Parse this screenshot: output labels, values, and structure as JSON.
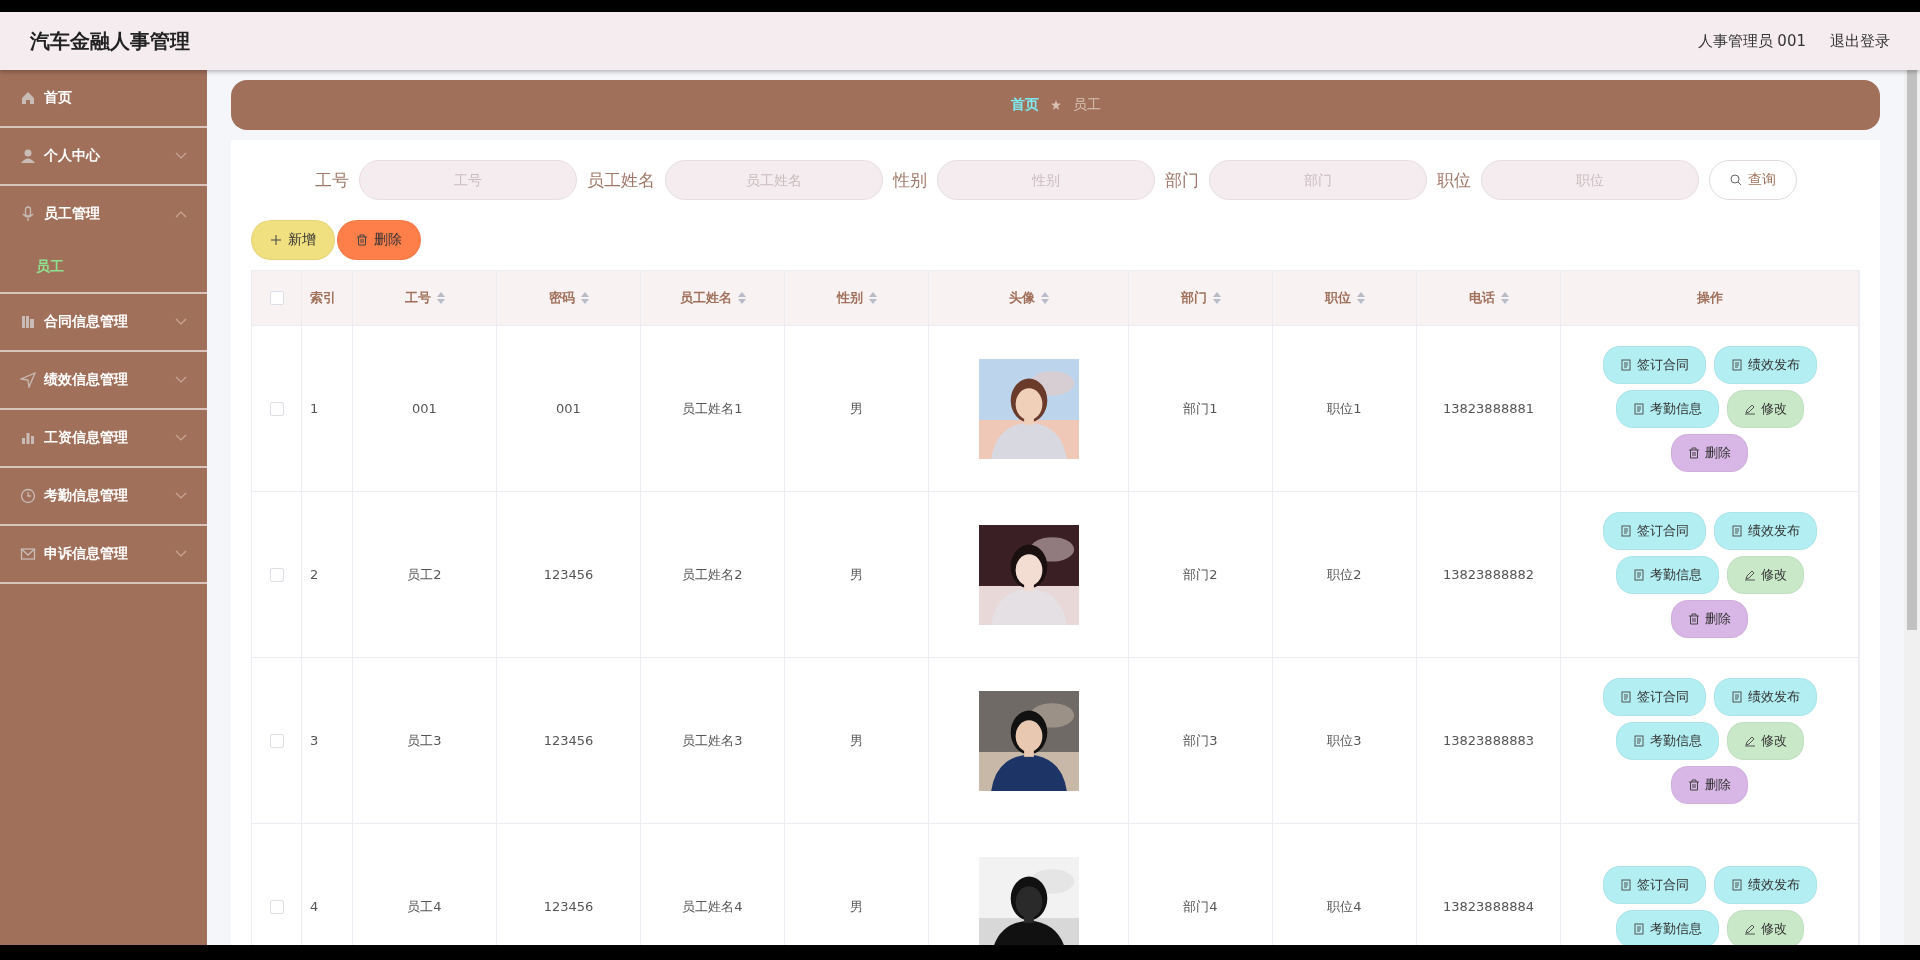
{
  "header": {
    "title": "汽车金融人事管理",
    "user": "人事管理员 001",
    "logout": "退出登录"
  },
  "sidebar": {
    "items": [
      {
        "label": "首页",
        "kind": "link"
      },
      {
        "label": "个人中心",
        "kind": "menu",
        "expanded": false
      },
      {
        "label": "员工管理",
        "kind": "menu",
        "expanded": true,
        "children": [
          {
            "label": "员工",
            "selected": true
          }
        ]
      },
      {
        "label": "合同信息管理",
        "kind": "menu",
        "expanded": false
      },
      {
        "label": "绩效信息管理",
        "kind": "menu",
        "expanded": false
      },
      {
        "label": "工资信息管理",
        "kind": "menu",
        "expanded": false
      },
      {
        "label": "考勤信息管理",
        "kind": "menu",
        "expanded": false
      },
      {
        "label": "申诉信息管理",
        "kind": "menu",
        "expanded": false
      }
    ]
  },
  "breadcrumb": [
    {
      "label": "首页",
      "current": false
    },
    {
      "label": "员工",
      "current": true
    }
  ],
  "search": {
    "fields": [
      {
        "label": "工号",
        "placeholder": "工号"
      },
      {
        "label": "员工姓名",
        "placeholder": "员工姓名"
      },
      {
        "label": "性别",
        "placeholder": "性别"
      },
      {
        "label": "部门",
        "placeholder": "部门"
      },
      {
        "label": "职位",
        "placeholder": "职位"
      }
    ],
    "button": "查询"
  },
  "toolbar": [
    {
      "kind": "add",
      "label": "新增"
    },
    {
      "kind": "delete",
      "label": "删除"
    }
  ],
  "table": {
    "select_all": {
      "checked": false
    },
    "columns": [
      {
        "label": "索引",
        "sortable": false
      },
      {
        "label": "工号",
        "sortable": true
      },
      {
        "label": "密码",
        "sortable": true
      },
      {
        "label": "员工姓名",
        "sortable": true
      },
      {
        "label": "性别",
        "sortable": true
      },
      {
        "label": "头像",
        "sortable": true
      },
      {
        "label": "部门",
        "sortable": true
      },
      {
        "label": "职位",
        "sortable": true
      },
      {
        "label": "电话",
        "sortable": true
      },
      {
        "label": "操作",
        "sortable": false
      }
    ],
    "rows": [
      {
        "checked": false,
        "cells": [
          {
            "kind": "text",
            "text": "1"
          },
          {
            "kind": "text",
            "text": "001"
          },
          {
            "kind": "text",
            "text": "001"
          },
          {
            "kind": "text",
            "text": "员工姓名1"
          },
          {
            "kind": "text",
            "text": "男"
          },
          {
            "kind": "picture"
          },
          {
            "kind": "text",
            "text": "部门1"
          },
          {
            "kind": "text",
            "text": "职位1"
          },
          {
            "kind": "text",
            "text": "13823888881"
          }
        ],
        "actions": [
          {
            "kind": "doc",
            "label": "签订合同"
          },
          {
            "kind": "doc",
            "label": "绩效发布"
          },
          {
            "kind": "doc",
            "label": "考勤信息"
          },
          {
            "kind": "edit",
            "label": "修改"
          },
          {
            "kind": "delete",
            "label": "删除"
          }
        ]
      },
      {
        "checked": false,
        "cells": [
          {
            "kind": "text",
            "text": "2"
          },
          {
            "kind": "text",
            "text": "员工2"
          },
          {
            "kind": "text",
            "text": "123456"
          },
          {
            "kind": "text",
            "text": "员工姓名2"
          },
          {
            "kind": "text",
            "text": "男"
          },
          {
            "kind": "picture"
          },
          {
            "kind": "text",
            "text": "部门2"
          },
          {
            "kind": "text",
            "text": "职位2"
          },
          {
            "kind": "text",
            "text": "13823888882"
          }
        ],
        "actions": [
          {
            "kind": "doc",
            "label": "签订合同"
          },
          {
            "kind": "doc",
            "label": "绩效发布"
          },
          {
            "kind": "doc",
            "label": "考勤信息"
          },
          {
            "kind": "edit",
            "label": "修改"
          },
          {
            "kind": "delete",
            "label": "删除"
          }
        ]
      },
      {
        "checked": false,
        "cells": [
          {
            "kind": "text",
            "text": "3"
          },
          {
            "kind": "text",
            "text": "员工3"
          },
          {
            "kind": "text",
            "text": "123456"
          },
          {
            "kind": "text",
            "text": "员工姓名3"
          },
          {
            "kind": "text",
            "text": "男"
          },
          {
            "kind": "picture"
          },
          {
            "kind": "text",
            "text": "部门3"
          },
          {
            "kind": "text",
            "text": "职位3"
          },
          {
            "kind": "text",
            "text": "13823888883"
          }
        ],
        "actions": [
          {
            "kind": "doc",
            "label": "签订合同"
          },
          {
            "kind": "doc",
            "label": "绩效发布"
          },
          {
            "kind": "doc",
            "label": "考勤信息"
          },
          {
            "kind": "edit",
            "label": "修改"
          },
          {
            "kind": "delete",
            "label": "删除"
          }
        ]
      },
      {
        "checked": false,
        "cells": [
          {
            "kind": "text",
            "text": "4"
          },
          {
            "kind": "text",
            "text": "员工4"
          },
          {
            "kind": "text",
            "text": "123456"
          },
          {
            "kind": "text",
            "text": "员工姓名4"
          },
          {
            "kind": "text",
            "text": "男"
          },
          {
            "kind": "picture"
          },
          {
            "kind": "text",
            "text": "部门4"
          },
          {
            "kind": "text",
            "text": "职位4"
          },
          {
            "kind": "text",
            "text": "13823888884"
          }
        ],
        "actions": [
          {
            "kind": "doc",
            "label": "签订合同"
          },
          {
            "kind": "doc",
            "label": "绩效发布"
          },
          {
            "kind": "doc",
            "label": "考勤信息"
          },
          {
            "kind": "edit",
            "label": "修改"
          }
        ]
      }
    ]
  }
}
